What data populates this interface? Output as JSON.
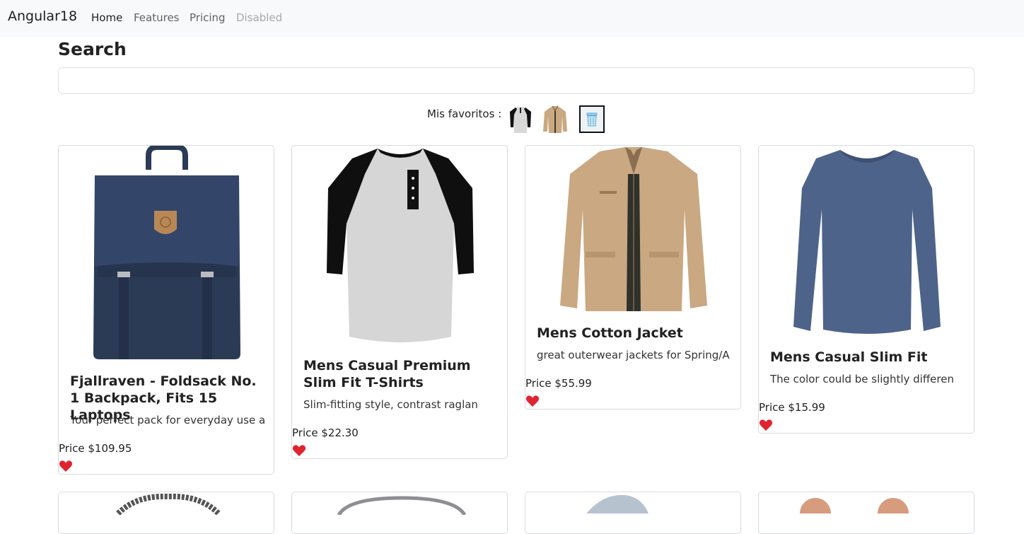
{
  "navbar": {
    "brand": "Angular18",
    "links": [
      {
        "label": "Home"
      },
      {
        "label": "Features"
      },
      {
        "label": "Pricing"
      },
      {
        "label": "Disabled"
      }
    ]
  },
  "search": {
    "title": "Search",
    "value": "",
    "placeholder": ""
  },
  "favorites": {
    "label": "Mis favoritos :",
    "items": [
      {
        "icon": "raglan-tshirt-thumbnail"
      },
      {
        "icon": "cotton-jacket-thumbnail"
      }
    ],
    "clear_icon": "trash-icon"
  },
  "products": [
    {
      "title": "Fjallraven - Foldsack No. 1 Backpack, Fits 15 Laptops",
      "description": "Your perfect pack for everyday use a",
      "price": "Price $109.95",
      "image": "navy-backpack-image"
    },
    {
      "title": "Mens Casual Premium Slim Fit T-Shirts",
      "description": "Slim-fitting style, contrast raglan",
      "price": "Price $22.30",
      "image": "raglan-tshirt-image"
    },
    {
      "title": "Mens Cotton Jacket",
      "description": "great outerwear jackets for Spring/A",
      "price": "Price $55.99",
      "image": "cotton-jacket-image"
    },
    {
      "title": "Mens Casual Slim Fit",
      "description": "The color could be slightly differen",
      "price": "Price $15.99",
      "image": "blue-longsleeve-image"
    }
  ],
  "colors": {
    "navbar_bg": "#f8f9fa",
    "heart": "#e0242f",
    "backpack": "#2c3b55",
    "jacket": "#c9a882",
    "shirt": "#4e6389"
  }
}
